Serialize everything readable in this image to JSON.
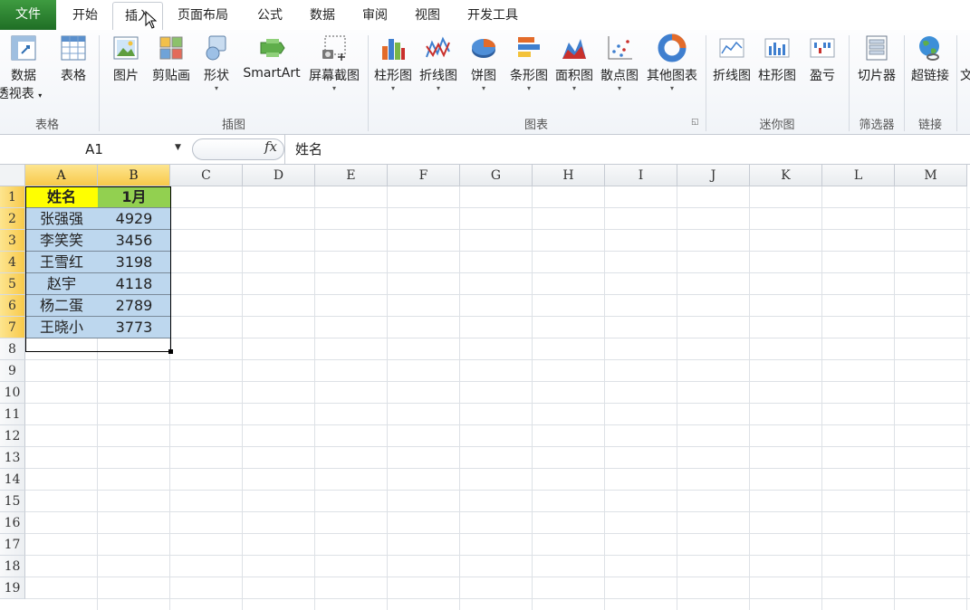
{
  "tabs": [
    {
      "label": "文件"
    },
    {
      "label": "开始"
    },
    {
      "label": "插入"
    },
    {
      "label": "页面布局"
    },
    {
      "label": "公式"
    },
    {
      "label": "数据"
    },
    {
      "label": "审阅"
    },
    {
      "label": "视图"
    },
    {
      "label": "开发工具"
    }
  ],
  "active_tab": "插入",
  "ribbon": {
    "groups": {
      "tables": "表格",
      "illustrations": "插图",
      "charts": "图表",
      "sparklines": "迷你图",
      "filters": "筛选器",
      "links": "链接"
    },
    "buttons": {
      "pivot_line1": "数据",
      "pivot_line2": "透视表",
      "table": "表格",
      "picture": "图片",
      "clipart": "剪贴画",
      "shapes": "形状",
      "smartart": "SmartArt",
      "screenshot": "屏幕截图",
      "column_chart": "柱形图",
      "line_chart": "折线图",
      "pie_chart": "饼图",
      "bar_chart": "条形图",
      "area_chart": "面积图",
      "scatter_chart": "散点图",
      "other_charts": "其他图表",
      "spark_line": "折线图",
      "spark_column": "柱形图",
      "spark_winloss": "盈亏",
      "slicer": "切片器",
      "hyperlink": "超链接",
      "text_partial": "文"
    }
  },
  "formula_bar": {
    "name_box": "A1",
    "fx": "fx",
    "content": "姓名"
  },
  "sheet": {
    "columns": [
      "A",
      "B",
      "C",
      "D",
      "E",
      "F",
      "G",
      "H",
      "I",
      "J",
      "K",
      "L",
      "M"
    ],
    "rows": [
      "1",
      "2",
      "3",
      "4",
      "5",
      "6",
      "7",
      "8",
      "9",
      "10",
      "11",
      "12",
      "13",
      "14",
      "15",
      "16",
      "17",
      "18",
      "19"
    ],
    "headers": [
      "姓名",
      "1月"
    ],
    "data": [
      [
        "张强强",
        "4929"
      ],
      [
        "李笑笑",
        "3456"
      ],
      [
        "王雪红",
        "3198"
      ],
      [
        "赵宇",
        "4118"
      ],
      [
        "杨二蛋",
        "2789"
      ],
      [
        "王晓小",
        "3773"
      ]
    ]
  },
  "colors": {
    "file_tab": "#2f7d32",
    "header_a": "#ffff00",
    "header_b": "#92d050",
    "data_fill": "#bdd7ee",
    "selected_header": "#f8c94a"
  }
}
